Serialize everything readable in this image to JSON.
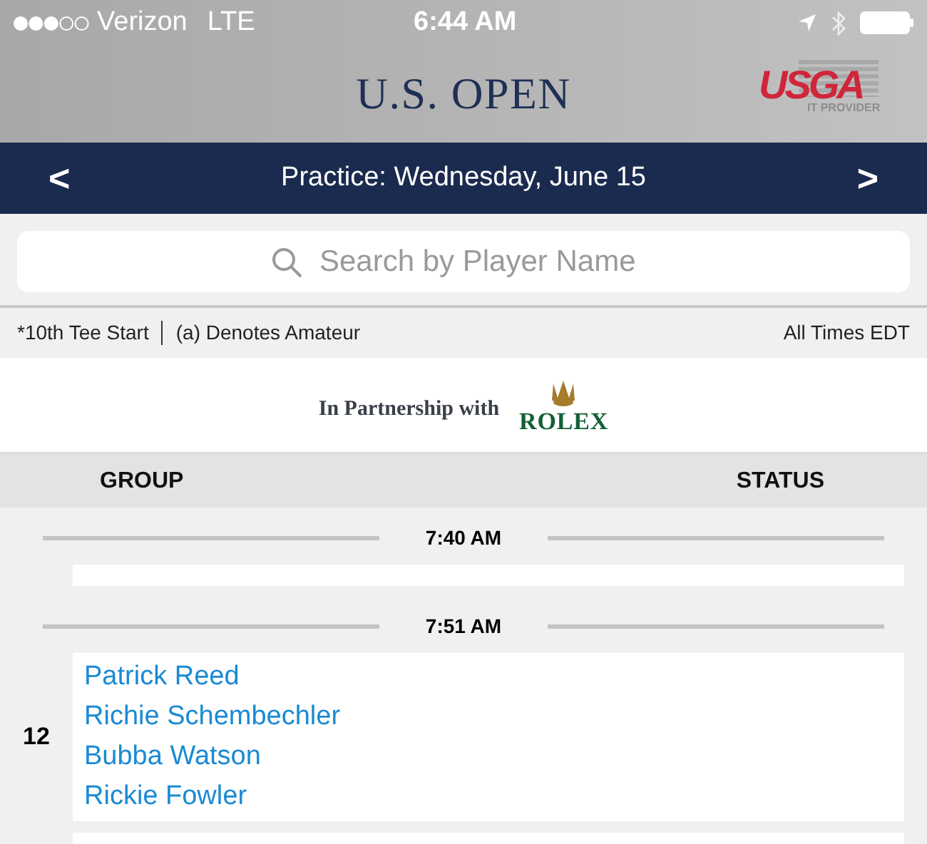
{
  "status_bar": {
    "carrier": "Verizon",
    "network": "LTE",
    "time": "6:44 AM"
  },
  "header": {
    "title": "U.S. OPEN",
    "logo": {
      "text": "USGA",
      "subtext": "IT PROVIDER"
    }
  },
  "day_nav": {
    "label": "Practice: Wednesday, June 15",
    "prev": "<",
    "next": ">"
  },
  "search": {
    "placeholder": "Search by Player Name"
  },
  "legend": {
    "items": [
      "*10th Tee Start",
      "(a) Denotes Amateur"
    ],
    "timezone": "All Times EDT"
  },
  "partner": {
    "text": "In Partnership with",
    "brand": "ROLEX"
  },
  "columns": [
    "GROUP",
    "STATUS"
  ],
  "groups": [
    {
      "time": "7:40 AM"
    },
    {
      "time": "7:51 AM",
      "number": "12",
      "players": [
        "Patrick Reed",
        "Richie Schembechler",
        "Bubba Watson",
        "Rickie Fowler"
      ]
    }
  ]
}
